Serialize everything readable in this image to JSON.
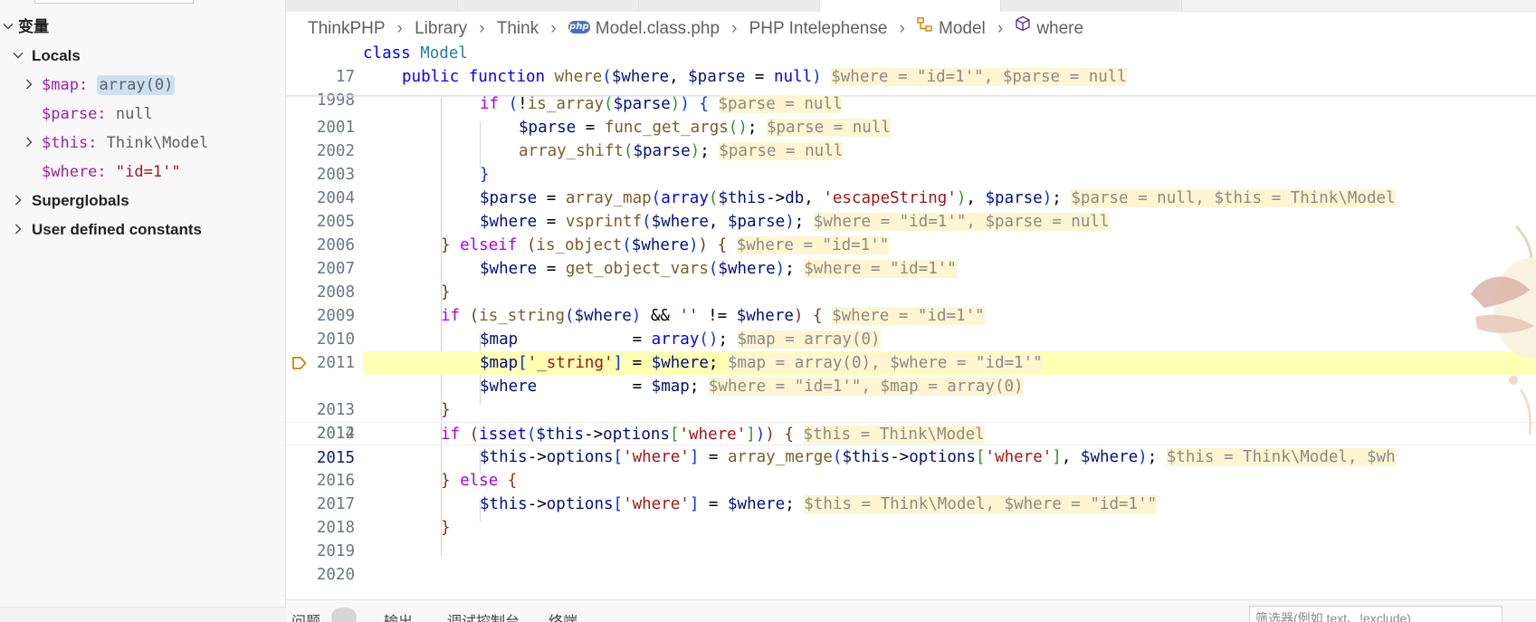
{
  "variables_panel": {
    "title": "变量",
    "locals_label": "Locals",
    "locals": [
      {
        "name": "$map",
        "sep": ": ",
        "value": "array(0)",
        "expandable": true,
        "selected": true
      },
      {
        "name": "$parse",
        "sep": ": ",
        "value": "null",
        "expandable": false
      },
      {
        "name": "$this",
        "sep": ": ",
        "value": "Think\\Model",
        "expandable": true
      },
      {
        "name": "$where",
        "sep": ": ",
        "value": "\"id=1'\"",
        "expandable": false
      }
    ],
    "superglobals_label": "Superglobals",
    "constants_label": "User defined constants"
  },
  "breadcrumb": {
    "items": [
      "ThinkPHP",
      "Library",
      "Think",
      "Model.class.php",
      "PHP Intelephense",
      "Model",
      "where"
    ],
    "php_badge": "php"
  },
  "editor": {
    "line_numbers": [
      "17",
      "1998",
      "2001",
      "2002",
      "2003",
      "2004",
      "2005",
      "2006",
      "2007",
      "2008",
      "2009",
      "2010",
      "2011",
      "2012",
      "2013",
      "2014",
      "2015",
      "2016",
      "2017",
      "2018",
      "2019",
      "2020"
    ],
    "inline_values": {
      "l1998": "$where = \"id=1'\", $parse = null",
      "l2001": "$parse = null",
      "l2002": "$parse = null",
      "l2003": "$parse = null",
      "l2005": "$parse = null, $this = Think\\Model",
      "l2006": "$where = \"id=1'\", $parse = null",
      "l2007": "$where = \"id=1'\"",
      "l2008": "$where = \"id=1'\"",
      "l2010": "$where = \"id=1'\"",
      "l2011": "$map = array(0)",
      "l2012": "$map = array(0), $where = \"id=1'\"",
      "l2013": "$where = \"id=1'\", $map = array(0)",
      "l2015": "$this = Think\\Model",
      "l2016": "$this = Think\\Model, $wh",
      "l2018": "$this = Think\\Model, $where = \"id=1'\""
    },
    "current_line": "2012"
  },
  "bottom_panel": {
    "tabs": [
      "问题",
      "输出",
      "调试控制台",
      "终端"
    ],
    "filter_placeholder": "筛选器(例如 text、!exclude)"
  },
  "colors": {
    "keyword": "#0000ff",
    "control": "#af00db",
    "variable": "#001080",
    "string": "#a31515",
    "function": "#795e26",
    "class": "#267f99",
    "inline_bg": "#fff5d1",
    "current_line_bg": "#ffffb4",
    "selected_value_bg": "#cde0f2"
  }
}
